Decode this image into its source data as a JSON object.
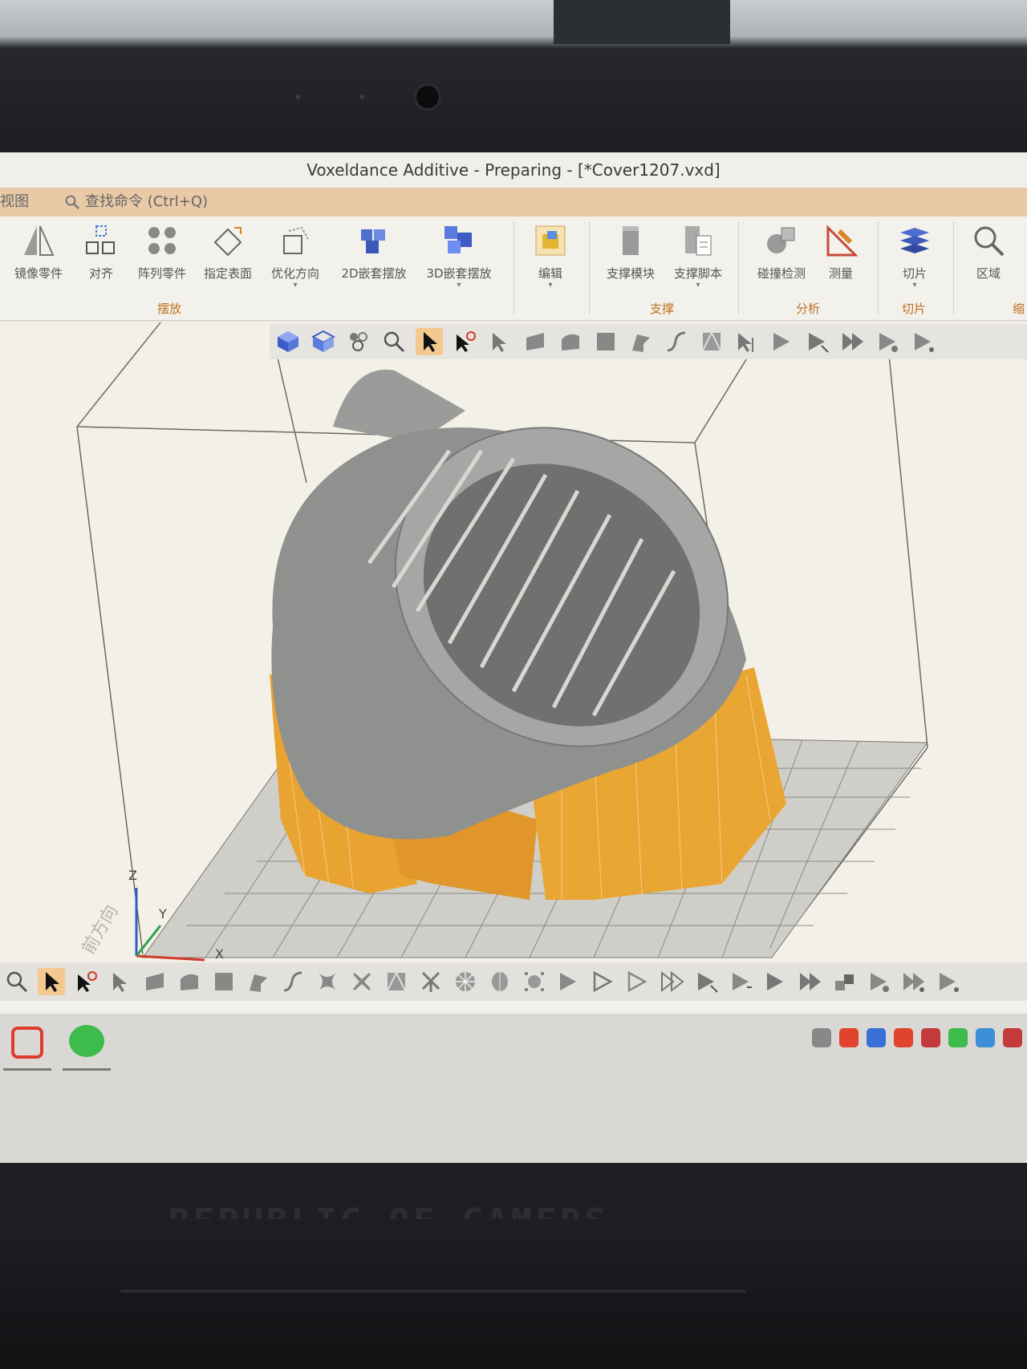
{
  "window": {
    "title": "Voxeldance Additive - Preparing - [*Cover1207.vxd]"
  },
  "menu": {
    "view_tab": "视图",
    "search_placeholder": "查找命令 (Ctrl+Q)"
  },
  "ribbon": {
    "placement": [
      {
        "label": "镜像零件",
        "icon": "mirror-icon"
      },
      {
        "label": "对齐",
        "icon": "align-icon"
      },
      {
        "label": "阵列零件",
        "icon": "array-icon"
      },
      {
        "label": "指定表面",
        "icon": "surface-icon"
      },
      {
        "label": "优化方向",
        "icon": "orientation-icon"
      },
      {
        "label": "2D嵌套摆放",
        "icon": "nest-2d-icon"
      },
      {
        "label": "3D嵌套摆放",
        "icon": "nest-3d-icon"
      }
    ],
    "edit": {
      "label": "编辑",
      "icon": "edit-icon"
    },
    "support": [
      {
        "label": "支撑模块",
        "icon": "support-module-icon"
      },
      {
        "label": "支撑脚本",
        "icon": "support-script-icon"
      }
    ],
    "analysis": [
      {
        "label": "碰撞检测",
        "icon": "collision-icon"
      },
      {
        "label": "测量",
        "icon": "measure-icon"
      }
    ],
    "slice": {
      "label": "切片",
      "icon": "slice-icon"
    },
    "zone": {
      "label": "区域",
      "icon": "zoom-region-icon"
    },
    "groups": {
      "placement": "摆放",
      "support": "支撑",
      "analysis": "分析",
      "slice": "切片",
      "zoom": "缩"
    }
  },
  "viewport": {
    "axis_x": "X",
    "axis_y": "Y",
    "axis_z": "Z",
    "front_label": "前方向"
  },
  "brand": {
    "text": "REPUBLIC OF GAMERS"
  },
  "colors": {
    "support": "#e8a330",
    "part": "#8f918f",
    "accent": "#c0701f"
  }
}
